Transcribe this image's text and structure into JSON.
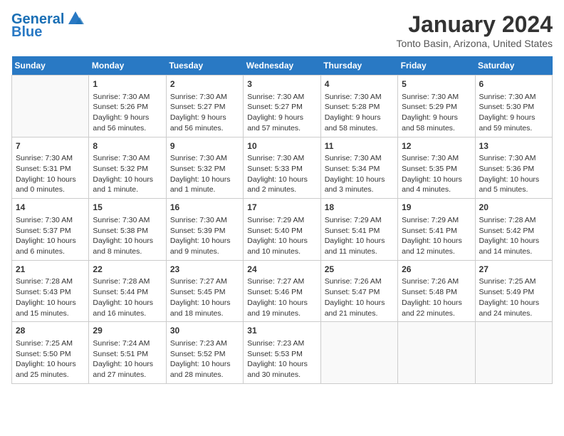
{
  "logo": {
    "line1": "General",
    "line2": "Blue"
  },
  "title": "January 2024",
  "subtitle": "Tonto Basin, Arizona, United States",
  "weekdays": [
    "Sunday",
    "Monday",
    "Tuesday",
    "Wednesday",
    "Thursday",
    "Friday",
    "Saturday"
  ],
  "weeks": [
    [
      {
        "day": "",
        "info": ""
      },
      {
        "day": "1",
        "info": "Sunrise: 7:30 AM\nSunset: 5:26 PM\nDaylight: 9 hours\nand 56 minutes."
      },
      {
        "day": "2",
        "info": "Sunrise: 7:30 AM\nSunset: 5:27 PM\nDaylight: 9 hours\nand 56 minutes."
      },
      {
        "day": "3",
        "info": "Sunrise: 7:30 AM\nSunset: 5:27 PM\nDaylight: 9 hours\nand 57 minutes."
      },
      {
        "day": "4",
        "info": "Sunrise: 7:30 AM\nSunset: 5:28 PM\nDaylight: 9 hours\nand 58 minutes."
      },
      {
        "day": "5",
        "info": "Sunrise: 7:30 AM\nSunset: 5:29 PM\nDaylight: 9 hours\nand 58 minutes."
      },
      {
        "day": "6",
        "info": "Sunrise: 7:30 AM\nSunset: 5:30 PM\nDaylight: 9 hours\nand 59 minutes."
      }
    ],
    [
      {
        "day": "7",
        "info": "Sunrise: 7:30 AM\nSunset: 5:31 PM\nDaylight: 10 hours\nand 0 minutes."
      },
      {
        "day": "8",
        "info": "Sunrise: 7:30 AM\nSunset: 5:32 PM\nDaylight: 10 hours\nand 1 minute."
      },
      {
        "day": "9",
        "info": "Sunrise: 7:30 AM\nSunset: 5:32 PM\nDaylight: 10 hours\nand 1 minute."
      },
      {
        "day": "10",
        "info": "Sunrise: 7:30 AM\nSunset: 5:33 PM\nDaylight: 10 hours\nand 2 minutes."
      },
      {
        "day": "11",
        "info": "Sunrise: 7:30 AM\nSunset: 5:34 PM\nDaylight: 10 hours\nand 3 minutes."
      },
      {
        "day": "12",
        "info": "Sunrise: 7:30 AM\nSunset: 5:35 PM\nDaylight: 10 hours\nand 4 minutes."
      },
      {
        "day": "13",
        "info": "Sunrise: 7:30 AM\nSunset: 5:36 PM\nDaylight: 10 hours\nand 5 minutes."
      }
    ],
    [
      {
        "day": "14",
        "info": "Sunrise: 7:30 AM\nSunset: 5:37 PM\nDaylight: 10 hours\nand 6 minutes."
      },
      {
        "day": "15",
        "info": "Sunrise: 7:30 AM\nSunset: 5:38 PM\nDaylight: 10 hours\nand 8 minutes."
      },
      {
        "day": "16",
        "info": "Sunrise: 7:30 AM\nSunset: 5:39 PM\nDaylight: 10 hours\nand 9 minutes."
      },
      {
        "day": "17",
        "info": "Sunrise: 7:29 AM\nSunset: 5:40 PM\nDaylight: 10 hours\nand 10 minutes."
      },
      {
        "day": "18",
        "info": "Sunrise: 7:29 AM\nSunset: 5:41 PM\nDaylight: 10 hours\nand 11 minutes."
      },
      {
        "day": "19",
        "info": "Sunrise: 7:29 AM\nSunset: 5:41 PM\nDaylight: 10 hours\nand 12 minutes."
      },
      {
        "day": "20",
        "info": "Sunrise: 7:28 AM\nSunset: 5:42 PM\nDaylight: 10 hours\nand 14 minutes."
      }
    ],
    [
      {
        "day": "21",
        "info": "Sunrise: 7:28 AM\nSunset: 5:43 PM\nDaylight: 10 hours\nand 15 minutes."
      },
      {
        "day": "22",
        "info": "Sunrise: 7:28 AM\nSunset: 5:44 PM\nDaylight: 10 hours\nand 16 minutes."
      },
      {
        "day": "23",
        "info": "Sunrise: 7:27 AM\nSunset: 5:45 PM\nDaylight: 10 hours\nand 18 minutes."
      },
      {
        "day": "24",
        "info": "Sunrise: 7:27 AM\nSunset: 5:46 PM\nDaylight: 10 hours\nand 19 minutes."
      },
      {
        "day": "25",
        "info": "Sunrise: 7:26 AM\nSunset: 5:47 PM\nDaylight: 10 hours\nand 21 minutes."
      },
      {
        "day": "26",
        "info": "Sunrise: 7:26 AM\nSunset: 5:48 PM\nDaylight: 10 hours\nand 22 minutes."
      },
      {
        "day": "27",
        "info": "Sunrise: 7:25 AM\nSunset: 5:49 PM\nDaylight: 10 hours\nand 24 minutes."
      }
    ],
    [
      {
        "day": "28",
        "info": "Sunrise: 7:25 AM\nSunset: 5:50 PM\nDaylight: 10 hours\nand 25 minutes."
      },
      {
        "day": "29",
        "info": "Sunrise: 7:24 AM\nSunset: 5:51 PM\nDaylight: 10 hours\nand 27 minutes."
      },
      {
        "day": "30",
        "info": "Sunrise: 7:23 AM\nSunset: 5:52 PM\nDaylight: 10 hours\nand 28 minutes."
      },
      {
        "day": "31",
        "info": "Sunrise: 7:23 AM\nSunset: 5:53 PM\nDaylight: 10 hours\nand 30 minutes."
      },
      {
        "day": "",
        "info": ""
      },
      {
        "day": "",
        "info": ""
      },
      {
        "day": "",
        "info": ""
      }
    ]
  ]
}
